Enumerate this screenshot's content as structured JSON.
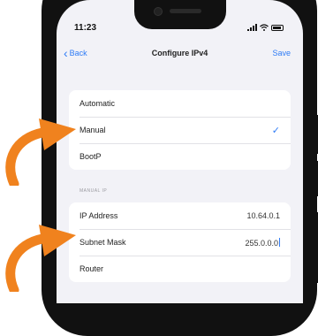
{
  "status": {
    "time": "11:23"
  },
  "navbar": {
    "back_label": "Back",
    "title": "Configure IPv4",
    "save_label": "Save"
  },
  "config_options": [
    {
      "label": "Automatic",
      "selected": false
    },
    {
      "label": "Manual",
      "selected": true
    },
    {
      "label": "BootP",
      "selected": false
    }
  ],
  "manual_ip": {
    "header": "MANUAL IP",
    "rows": [
      {
        "label": "IP Address",
        "value": "10.64.0.1"
      },
      {
        "label": "Subnet Mask",
        "value": "255.0.0.0"
      },
      {
        "label": "Router",
        "value": ""
      }
    ]
  },
  "colors": {
    "accent": "#2f7cf6",
    "arrow": "#f0821e",
    "background": "#f2f2f7"
  },
  "icons": [
    "chevron-left-icon",
    "checkmark-icon",
    "signal-icon",
    "wifi-icon",
    "battery-icon",
    "annotation-arrow"
  ]
}
